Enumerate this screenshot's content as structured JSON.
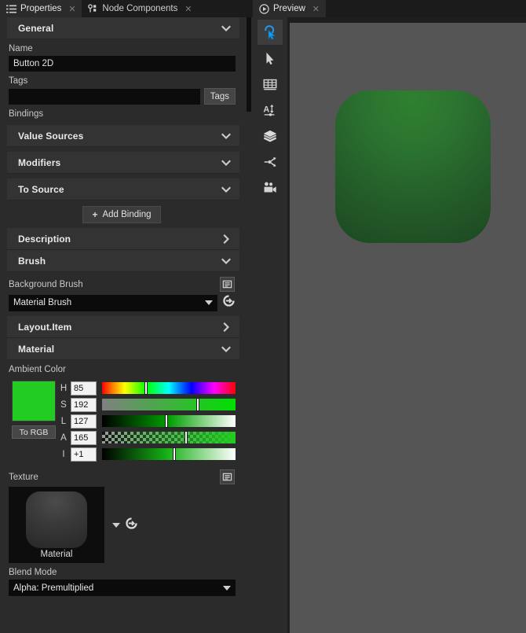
{
  "tabs": [
    {
      "label": "Properties",
      "icon": "list-icon",
      "active": true,
      "close": "✕"
    },
    {
      "label": "Node Components",
      "icon": "node-icon",
      "active": false,
      "close": "✕"
    }
  ],
  "properties": {
    "general": {
      "title": "General",
      "expanded": true,
      "name_label": "Name",
      "name_value": "Button 2D",
      "tags_label": "Tags",
      "tags_value": "",
      "tags_button": "Tags",
      "bindings_label": "Bindings",
      "binding_sections": [
        {
          "title": "Value Sources",
          "expanded": true
        },
        {
          "title": "Modifiers",
          "expanded": true
        },
        {
          "title": "To Source",
          "expanded": true
        }
      ],
      "add_binding": "Add Binding",
      "add_binding_plus": "+"
    },
    "description": {
      "title": "Description",
      "expanded": false
    },
    "brush": {
      "title": "Brush",
      "expanded": true,
      "background_brush_label": "Background Brush",
      "background_brush_value": "Material Brush"
    },
    "layout_item": {
      "title": "Layout.Item",
      "expanded": false
    },
    "material": {
      "title": "Material",
      "expanded": true,
      "ambient_color_label": "Ambient Color",
      "to_rgb_button": "To RGB",
      "swatch_color": "#22cc22",
      "channels": [
        {
          "label": "H",
          "value": "85",
          "pos": 33,
          "type": "hue"
        },
        {
          "label": "S",
          "value": "192",
          "pos": 72,
          "type": "sat"
        },
        {
          "label": "L",
          "value": "127",
          "pos": 48,
          "type": "lum"
        },
        {
          "label": "A",
          "value": "165",
          "pos": 63,
          "type": "alpha"
        },
        {
          "label": "I",
          "value": "+1",
          "pos": 54,
          "type": "int"
        }
      ],
      "texture_label": "Texture",
      "texture_name": "Material",
      "blend_mode_label": "Blend Mode",
      "blend_mode_value": "Alpha: Premultiplied"
    }
  },
  "preview": {
    "tab_label": "Preview",
    "tab_icon": "play-icon",
    "tab_close": "✕",
    "tools": [
      {
        "name": "select-click-tool",
        "selected": true
      },
      {
        "name": "arrow-cursor-tool",
        "selected": false
      },
      {
        "name": "grid-table-tool",
        "selected": false
      },
      {
        "name": "text-layout-tool",
        "selected": false
      },
      {
        "name": "layers-tool",
        "selected": false
      },
      {
        "name": "node-graph-tool",
        "selected": false
      },
      {
        "name": "camera-tool",
        "selected": false
      }
    ],
    "canvas_bg": "#555555",
    "object_color": "#2b7430"
  }
}
